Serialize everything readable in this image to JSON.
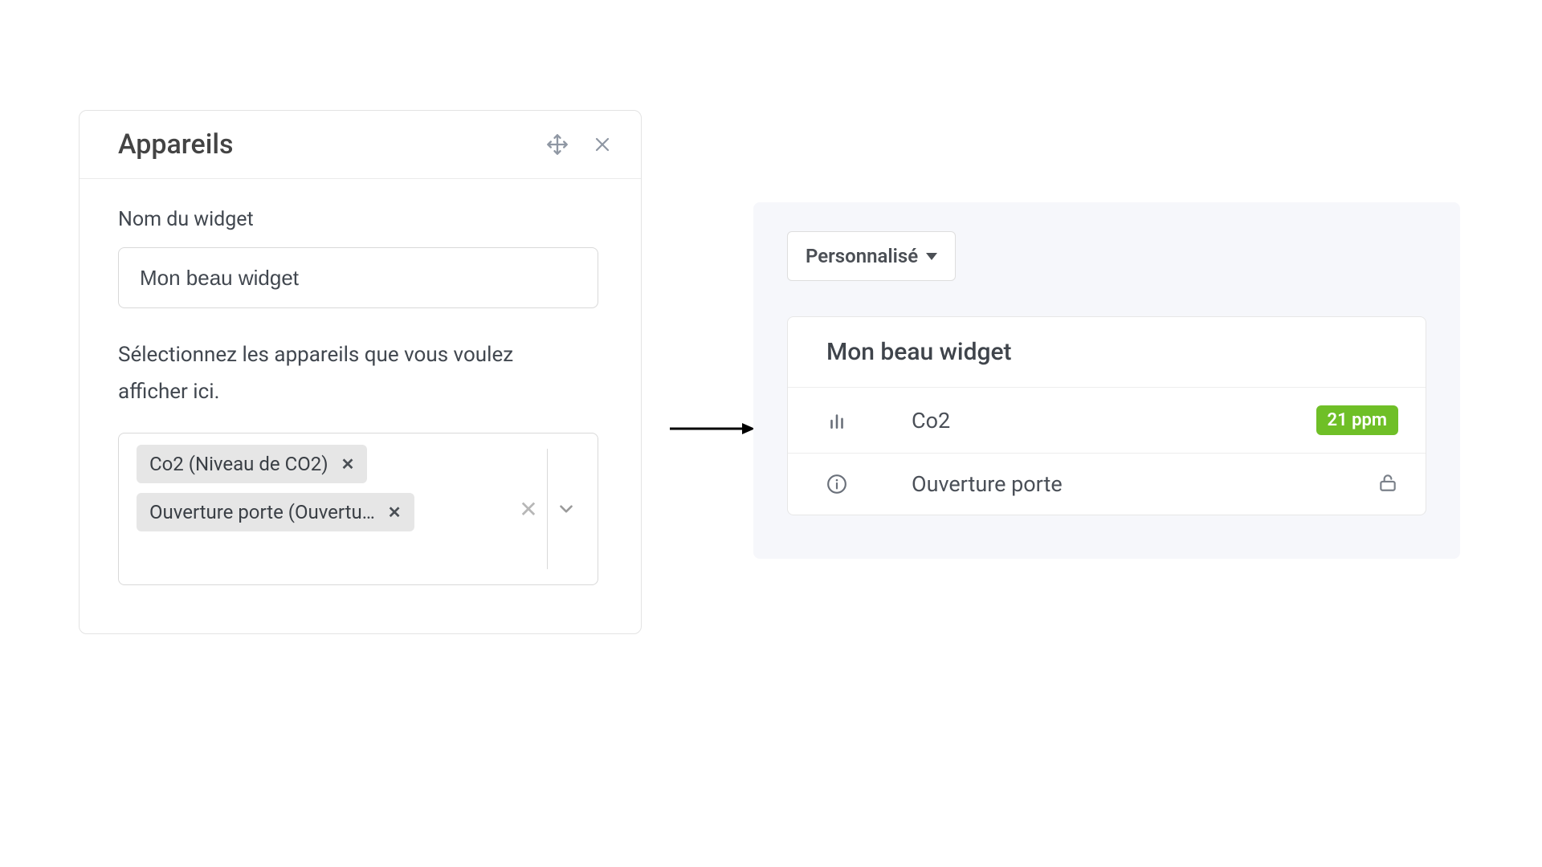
{
  "config": {
    "title": "Appareils",
    "name_label": "Nom du widget",
    "name_value": "Mon beau widget",
    "help_text": "Sélectionnez les appareils que vous voulez afficher ici.",
    "tags": [
      {
        "label": "Co2 (Niveau de CO2)"
      },
      {
        "label": "Ouverture porte (Ouvertu…"
      }
    ]
  },
  "preview": {
    "dropdown_label": "Personnalisé",
    "widget_title": "Mon beau widget",
    "rows": [
      {
        "icon": "bar-chart-icon",
        "label": "Co2",
        "value": "21 ppm",
        "badge": "green"
      },
      {
        "icon": "info-icon",
        "label": "Ouverture porte",
        "value": "",
        "trailing_icon": "unlock-icon"
      }
    ]
  }
}
